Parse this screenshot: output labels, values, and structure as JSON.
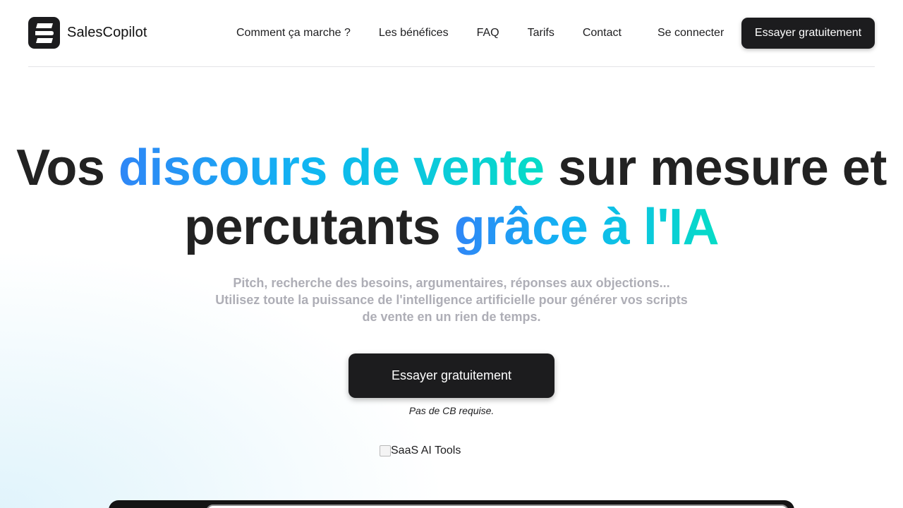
{
  "header": {
    "brand_name": "SalesCopilot",
    "logo_icon": "salescopilot-s-logo-icon",
    "nav": [
      {
        "label": "Comment ça marche ?"
      },
      {
        "label": "Les bénéfices"
      },
      {
        "label": "FAQ"
      },
      {
        "label": "Tarifs"
      },
      {
        "label": "Contact"
      }
    ],
    "login_label": "Se connecter",
    "cta_label": "Essayer gratuitement"
  },
  "hero": {
    "title_part1": "Vos ",
    "title_highlight1": "discours de vente",
    "title_part2": " sur mesure et",
    "title_part3": "percutants ",
    "title_highlight2": "grâce à l'IA",
    "subtitle_line1": "Pitch, recherche des besoins, argumentaires, réponses aux objections...",
    "subtitle_line2": "Utilisez toute la puissance de l'intelligence artificielle pour générer vos scripts de vente en un rien de temps.",
    "cta_label": "Essayer gratuitement",
    "cta_note": "Pas de CB requise.",
    "badge_alt": "SaaS AI Tools"
  },
  "colors": {
    "dark": "#1c1c1e",
    "gradient_start": "#2f86f6",
    "gradient_end": "#06dcc6",
    "subtitle": "#aeaeb6"
  }
}
